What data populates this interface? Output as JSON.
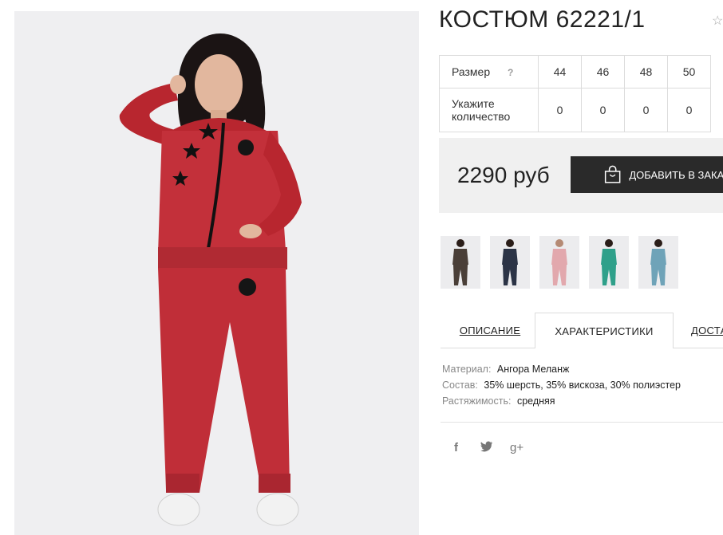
{
  "product": {
    "title": "КОСТЮМ 62221/1",
    "price": "2290 руб",
    "order_button_label": "ДОБАВИТЬ В ЗАКАЗ"
  },
  "size_table": {
    "size_label": "Размер",
    "help_mark": "?",
    "sizes": [
      "44",
      "46",
      "48",
      "50"
    ],
    "qty_label_line1": "Укажите",
    "qty_label_line2": "количество",
    "quantities": [
      "0",
      "0",
      "0",
      "0"
    ]
  },
  "tabs": [
    "ОПИСАНИЕ",
    "ХАРАКТЕРИСТИКИ",
    "ДОСТАВКА"
  ],
  "properties": [
    {
      "key": "Материал:",
      "value": "Ангора Меланж"
    },
    {
      "key": "Состав:",
      "value": "35% шерсть, 35% вискоза, 30% полиэстер"
    },
    {
      "key": "Растяжимость:",
      "value": "средняя"
    }
  ],
  "social": {
    "facebook": "f",
    "twitter": "🐦",
    "googleplus": "g+"
  },
  "icons": [
    "star-favorite-icon",
    "shopping-bag-icon",
    "facebook-icon",
    "twitter-icon",
    "google-plus-icon"
  ],
  "thumbnail_colors": [
    "#4a3f38",
    "#2c3446",
    "#e2a8ad",
    "#2fa08a",
    "#6fa3b8"
  ],
  "colors": {
    "suit": "#c3303a",
    "button": "#2a2a2a",
    "price_bg": "#f0f0f0"
  }
}
